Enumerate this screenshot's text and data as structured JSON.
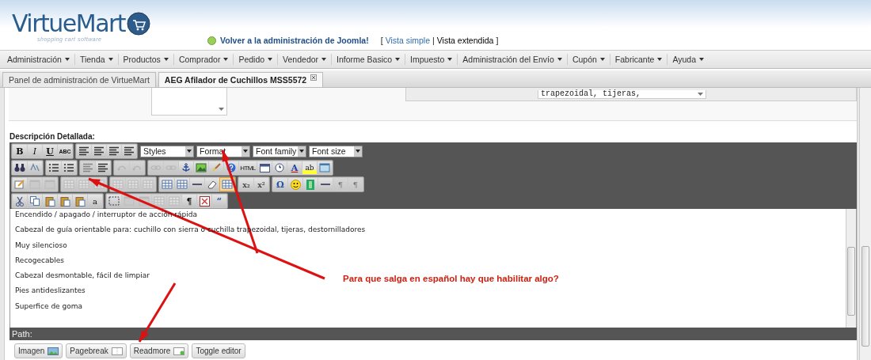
{
  "header": {
    "logo": {
      "name": "VirtueMart",
      "tagline": "shopping cart software"
    },
    "back_link": "Volver a la administración de Joomla!",
    "view_switch": {
      "open": "[",
      "separator": "|",
      "close": "]",
      "items": [
        {
          "label": "Vista simple",
          "selected": false
        },
        {
          "label": "Vista extendida",
          "selected": true
        }
      ]
    }
  },
  "menu": [
    "Administración",
    "Tienda",
    "Productos",
    "Comprador",
    "Pedido",
    "Vendedor",
    "Informe Basico",
    "Impuesto",
    "Administración del Envío",
    "Cupón",
    "Fabricante",
    "Ayuda"
  ],
  "tabs": [
    {
      "label": "Panel de administración de VirtueMart",
      "selected": false
    },
    {
      "label": "AEG Afilador de Cuchillos MSS5572",
      "selected": true
    }
  ],
  "upper_form": {
    "side_select_value": "trapezoidal, tijeras,"
  },
  "editor": {
    "label": "Descripción Detallada:",
    "toolbar_rows": [
      {
        "groups": [
          [
            {
              "kind": "bold",
              "glyph": "B",
              "disabled": false
            },
            {
              "kind": "italic",
              "glyph": "I",
              "disabled": false
            },
            {
              "kind": "underline",
              "glyph": "U",
              "disabled": false
            },
            {
              "kind": "strike",
              "glyph": "ABC",
              "disabled": false
            }
          ],
          [
            {
              "kind": "lines",
              "disabled": false
            },
            {
              "kind": "lines",
              "disabled": false
            },
            {
              "kind": "lines",
              "disabled": false
            },
            {
              "kind": "lines",
              "disabled": false
            }
          ]
        ],
        "selects": [
          "Styles",
          "Format",
          "Font family",
          "Font size"
        ]
      },
      {
        "groups": [
          [
            {
              "kind": "search",
              "disabled": false
            },
            {
              "kind": "swap",
              "disabled": false
            }
          ],
          [
            {
              "kind": "list",
              "disabled": false
            },
            {
              "kind": "list",
              "disabled": false
            }
          ],
          [
            {
              "kind": "lines",
              "disabled": true
            },
            {
              "kind": "lines",
              "disabled": false
            }
          ],
          [
            {
              "kind": "curve",
              "disabled": true
            },
            {
              "kind": "curve",
              "disabled": true
            }
          ],
          [
            {
              "kind": "chain",
              "disabled": true
            },
            {
              "kind": "chain",
              "disabled": true
            },
            {
              "kind": "anchor",
              "disabled": false
            },
            {
              "kind": "picture",
              "disabled": false
            },
            {
              "kind": "brush",
              "disabled": false
            },
            {
              "kind": "help",
              "disabled": false
            },
            {
              "kind": "tiny",
              "glyph": "HTML",
              "disabled": false
            },
            {
              "kind": "calendar",
              "disabled": false
            },
            {
              "kind": "clock",
              "disabled": false
            },
            {
              "kind": "forecolor",
              "glyph": "A",
              "disabled": false
            },
            {
              "kind": "highlight",
              "glyph": "ab",
              "disabled": false
            },
            {
              "kind": "window",
              "disabled": false
            }
          ]
        ]
      },
      {
        "groups": [
          [
            {
              "kind": "note",
              "disabled": false
            },
            {
              "kind": "window",
              "disabled": true
            },
            {
              "kind": "window",
              "disabled": true
            }
          ],
          [
            {
              "kind": "grid",
              "disabled": true
            },
            {
              "kind": "grid",
              "disabled": true
            },
            {
              "kind": "grid",
              "disabled": true
            }
          ],
          [
            {
              "kind": "grid",
              "disabled": true
            },
            {
              "kind": "grid",
              "disabled": true
            },
            {
              "kind": "grid",
              "disabled": true
            }
          ],
          [
            {
              "kind": "grid",
              "disabled": false
            },
            {
              "kind": "grid",
              "disabled": false
            },
            {
              "kind": "rule",
              "disabled": false
            },
            {
              "kind": "eraser",
              "disabled": false
            },
            {
              "kind": "grid",
              "disabled": false,
              "active": true
            }
          ],
          [
            {
              "kind": "plain",
              "glyph": "x₂",
              "disabled": false
            },
            {
              "kind": "plain",
              "glyph": "x²",
              "disabled": false
            }
          ],
          [
            {
              "kind": "blue",
              "glyph": "Ω",
              "disabled": false
            },
            {
              "kind": "smiley",
              "disabled": false
            },
            {
              "kind": "film",
              "disabled": false
            },
            {
              "kind": "rule",
              "disabled": false
            },
            {
              "kind": "plain",
              "glyph": "¶",
              "disabled": true
            },
            {
              "kind": "plain",
              "glyph": "¶",
              "disabled": true
            }
          ]
        ]
      },
      {
        "groups": [
          [
            {
              "kind": "scissors",
              "disabled": false
            },
            {
              "kind": "copy",
              "disabled": false
            },
            {
              "kind": "paste",
              "disabled": false
            },
            {
              "kind": "paste",
              "disabled": false
            },
            {
              "kind": "paste",
              "disabled": false
            },
            {
              "kind": "plain",
              "glyph": "a",
              "disabled": false
            }
          ],
          [
            {
              "kind": "dashed",
              "disabled": false
            },
            {
              "kind": "window",
              "disabled": true
            },
            {
              "kind": "window",
              "disabled": true
            },
            {
              "kind": "grid",
              "disabled": true
            },
            {
              "kind": "grid",
              "disabled": true
            },
            {
              "kind": "bold",
              "glyph": "¶",
              "disabled": false
            },
            {
              "kind": "cross",
              "disabled": false
            },
            {
              "kind": "blue",
              "glyph": "“",
              "disabled": false
            }
          ]
        ]
      }
    ],
    "lines": [
      "Encendido / apagado / interruptor de acción rápida",
      "Cabezal de guía orientable para: cuchillo con sierra o cuchilla trapezoidal, tijeras, destornilladores",
      "Muy silencioso",
      "Recogecables",
      "Cabezal desmontable, fácil de limpiar",
      "Pies antideslizantes",
      "Superfice de goma"
    ],
    "path_label": "Path:",
    "buttons": [
      {
        "label": "Imagen",
        "kind": "image"
      },
      {
        "label": "Pagebreak",
        "kind": "page"
      },
      {
        "label": "Readmore",
        "kind": "more"
      },
      {
        "label": "Toggle editor",
        "kind": "none"
      }
    ]
  },
  "annotation": {
    "text": "Para que salga en español hay que habilitar algo?"
  }
}
